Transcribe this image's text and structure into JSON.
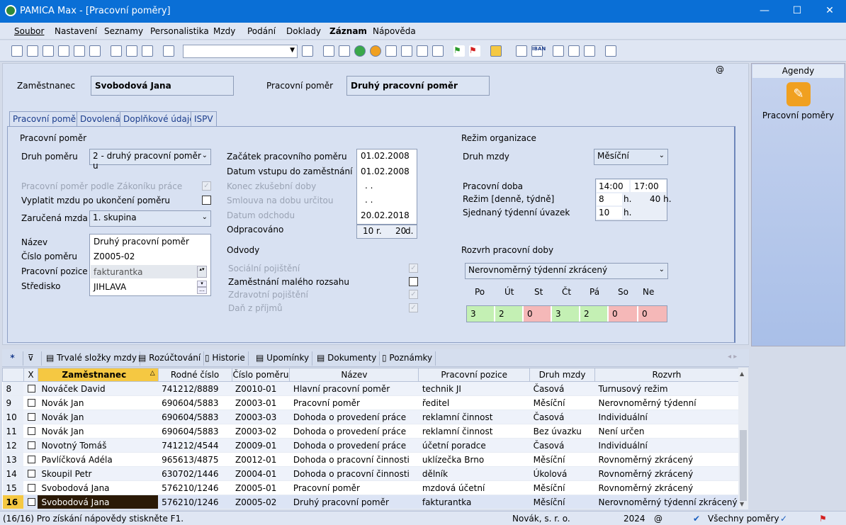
{
  "title": "PAMICA Max - [Pracovní poměry]",
  "window": {
    "minimize": "—",
    "maximize": "☐",
    "close": "✕"
  },
  "menu": [
    "Soubor",
    "Nastavení",
    "Seznamy",
    "Personalistika",
    "Mzdy",
    "Podání",
    "Doklady",
    "Záznam",
    "Nápověda"
  ],
  "at_sign": "@",
  "header": {
    "employee_label": "Zaměstnanec",
    "employee_value": "Svobodová Jana",
    "relation_label": "Pracovní poměr",
    "relation_value": "Druhý pracovní poměr"
  },
  "tabs": [
    "Pracovní poměr",
    "Dovolená",
    "Doplňkové údaje",
    "ISPV"
  ],
  "left": {
    "section": "Pracovní poměr",
    "druh_label": "Druh poměru",
    "druh_value": "2 - druhý pracovní poměr u",
    "zakonik_label": "Pracovní poměr podle Zákoníku práce",
    "vyplatit_label": "Vyplatit mzdu po ukončení poměru",
    "zarucena_label": "Zaručená mzda",
    "zarucena_value": "1. skupina",
    "nazev_label": "Název",
    "nazev_value": "Druhý pracovní poměr",
    "cislo_label": "Číslo poměru",
    "cislo_value": "Z0005-02",
    "pozice_label": "Pracovní pozice",
    "pozice_value": "fakturantka",
    "stredisko_label": "Středisko",
    "stredisko_value": "JIHLAVA"
  },
  "dates": {
    "zacatek_label": "Začátek pracovního poměru",
    "zacatek": "01.02.2008",
    "vstup_label": "Datum vstupu do zaměstnání",
    "vstup": "01.02.2008",
    "zkusebni_label": "Konec zkušební doby",
    "zkusebni": ". .",
    "smlouva_label": "Smlouva na dobu určitou",
    "smlouva": ". .",
    "odchod_label": "Datum odchodu",
    "odchod": "20.02.2018",
    "odpracovano_label": "Odpracováno",
    "odpracovano_r": "10",
    "r_unit": "r.",
    "odpracovano_d": "20",
    "d_unit": "d."
  },
  "odvody": {
    "section": "Odvody",
    "socialni": "Sociální pojištění",
    "maly_rozsah": "Zaměstnání malého rozsahu",
    "zdravotni": "Zdravotní pojištění",
    "dan": "Daň z příjmů"
  },
  "rezim": {
    "section": "Režim organizace",
    "druh_mzdy_label": "Druh mzdy",
    "druh_mzdy": "Měsíční",
    "doba_label": "Pracovní doba",
    "od": "14:00",
    "do": "17:00",
    "rezim_label": "Režim [denně, týdně]",
    "denne": "8",
    "h1": "h.",
    "tydne": "40 h.",
    "uvazek_label": "Sjednaný týdenní úvazek",
    "uvazek": "10",
    "h2": "h."
  },
  "rozvrh": {
    "section": "Rozvrh pracovní doby",
    "type": "Nerovnoměrný týdenní zkrácený",
    "days": [
      "Po",
      "Út",
      "St",
      "Čt",
      "Pá",
      "So",
      "Ne"
    ],
    "values": [
      "3",
      "2",
      "0",
      "3",
      "2",
      "0",
      "0"
    ],
    "colors": {
      "work": "#c4f0b4",
      "off": "#f5b8b8"
    }
  },
  "agendy": {
    "title": "Agendy",
    "item": "Pracovní poměry"
  },
  "bottom_tabs": [
    "*",
    "Trvalé složky mzdy",
    "Rozúčtování",
    "Historie",
    "Upomínky",
    "Dokumenty",
    "Poznámky"
  ],
  "table": {
    "headers": [
      "X",
      "Zaměstnanec",
      "Rodné číslo",
      "Číslo poměru",
      "Název",
      "Pracovní pozice",
      "Druh mzdy",
      "Rozvrh"
    ],
    "rows": [
      [
        "8",
        "Nováček David",
        "741212/8889",
        "Z0010-01",
        "Hlavní pracovní poměr",
        "technik JI",
        "Časová",
        "Turnusový režim"
      ],
      [
        "9",
        "Novák Jan",
        "690604/5883",
        "Z0003-01",
        "Pracovní poměr",
        "ředitel",
        "Měsíční",
        "Nerovnoměrný týdenní"
      ],
      [
        "10",
        "Novák Jan",
        "690604/5883",
        "Z0003-03",
        "Dohoda o provedení práce",
        "reklamní činnost",
        "Časová",
        "Individuální"
      ],
      [
        "11",
        "Novák Jan",
        "690604/5883",
        "Z0003-02",
        "Dohoda o provedení práce",
        "reklamní činnost",
        "Bez úvazku",
        "Není určen"
      ],
      [
        "12",
        "Novotný Tomáš",
        "741212/4544",
        "Z0009-01",
        "Dohoda o provedení práce",
        "účetní poradce",
        "Časová",
        "Individuální"
      ],
      [
        "13",
        "Pavlíčková Adéla",
        "965613/4875",
        "Z0012-01",
        "Dohoda o pracovní činnosti",
        "uklízečka Brno",
        "Měsíční",
        "Rovnoměrný zkrácený"
      ],
      [
        "14",
        "Skoupil Petr",
        "630702/1446",
        "Z0004-01",
        "Dohoda o pracovní činnosti",
        "dělník",
        "Úkolová",
        "Rovnoměrný zkrácený"
      ],
      [
        "15",
        "Svobodová Jana",
        "576210/1246",
        "Z0005-01",
        "Pracovní poměr",
        "mzdová účetní",
        "Měsíční",
        "Rovnoměrný zkrácený"
      ],
      [
        "16",
        "Svobodová Jana",
        "576210/1246",
        "Z0005-02",
        "Druhý pracovní poměr",
        "fakturantka",
        "Měsíční",
        "Nerovnoměrný týdenní zkrácený"
      ]
    ]
  },
  "status": {
    "help": "(16/16) Pro získání nápovědy stiskněte F1.",
    "company": "Novák, s. r. o.",
    "year": "2024",
    "at": "@",
    "filter": "Všechny poměry"
  }
}
